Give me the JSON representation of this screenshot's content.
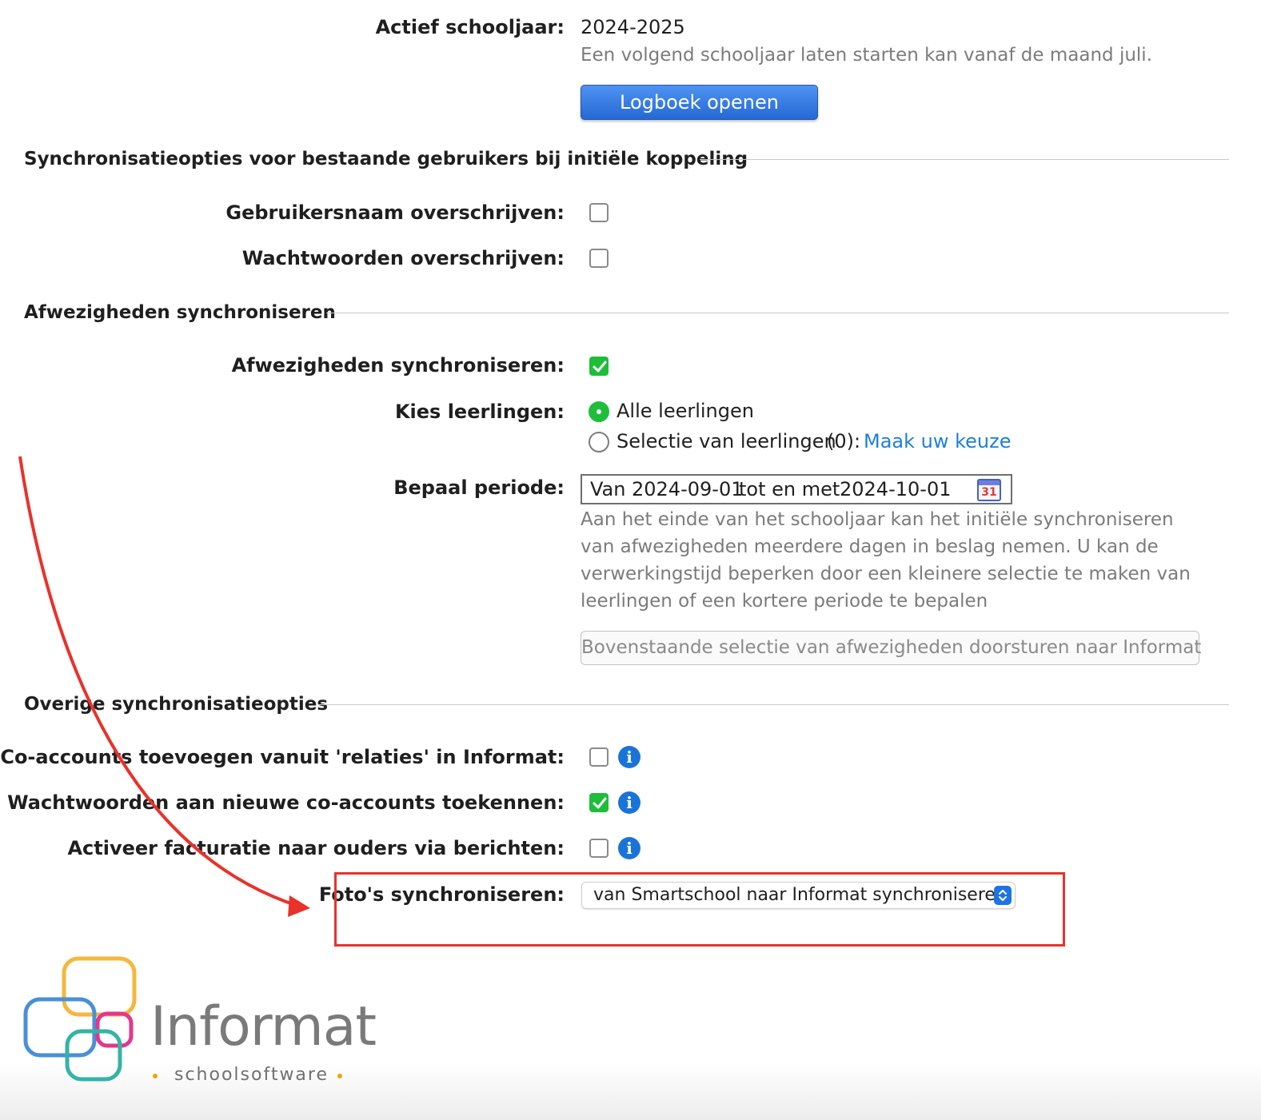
{
  "school_year": {
    "label": "Actief schooljaar:",
    "value": "2024-2025",
    "help": "Een volgend schooljaar laten starten kan vanaf de maand juli.",
    "logbook_button": "Logboek openen"
  },
  "section_initial": {
    "title": "Synchronisatieopties voor bestaande gebruikers bij initiële koppeling",
    "overwrite_username_label": "Gebruikersnaam overschrijven:",
    "overwrite_username_checked": false,
    "overwrite_passwords_label": "Wachtwoorden overschrijven:",
    "overwrite_passwords_checked": false
  },
  "section_absences": {
    "title": "Afwezigheden synchroniseren",
    "sync_label": "Afwezigheden synchroniseren:",
    "sync_checked": true,
    "students_label": "Kies leerlingen:",
    "option_all": "Alle leerlingen",
    "option_selection": "Selectie van leerlingen",
    "selection_count": "(0):",
    "choose_link": "Maak uw keuze",
    "period_label": "Bepaal periode:",
    "period_from_word": "Van",
    "period_from": "2024-09-01",
    "period_to_word": "tot en met",
    "period_to": "2024-10-01",
    "calendar_day": "31",
    "period_help": [
      "Aan het einde van het schooljaar kan het initiële synchroniseren",
      "van afwezigheden meerdere dagen in beslag nemen. U kan de",
      "verwerkingstijd beperken door een kleinere selectie te maken van",
      "leerlingen of een kortere periode te bepalen"
    ],
    "forward_button": "Bovenstaande selectie van afwezigheden doorsturen naar Informat"
  },
  "section_other": {
    "title": "Overige synchronisatieopties",
    "coaccounts_label": "Co-accounts toevoegen vanuit 'relaties' in Informat:",
    "coaccounts_checked": false,
    "coaccount_passwords_label": "Wachtwoorden aan nieuwe co-accounts toekennen:",
    "coaccount_passwords_checked": true,
    "billing_label": "Activeer facturatie naar ouders via berichten:",
    "billing_checked": false,
    "photos_label": "Foto's synchroniseren:",
    "photos_selected": "van Smartschool naar Informat synchroniseren"
  },
  "logo": {
    "name": "Informat",
    "tagline": "schoolsoftware"
  },
  "colors": {
    "accent_blue": "#2469d4",
    "check_green": "#1ebd3a",
    "annotation_red": "#e8322b",
    "link_blue": "#1f7fd6"
  }
}
